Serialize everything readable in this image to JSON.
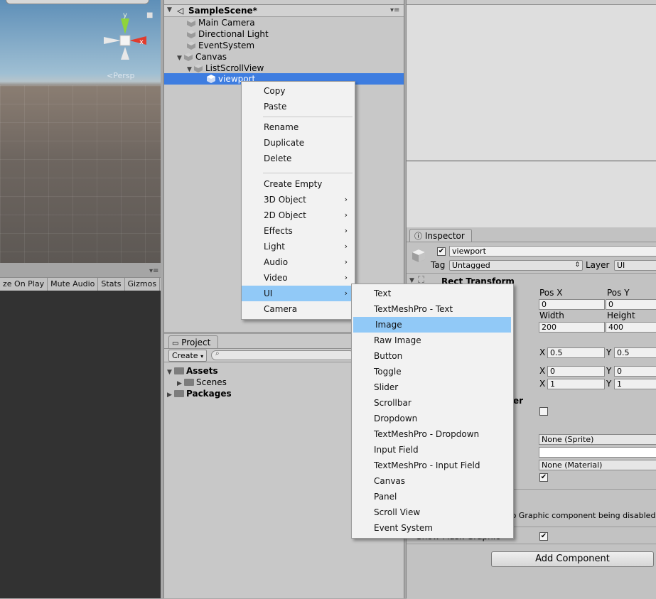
{
  "scene_view": {
    "persp_label": "<Persp",
    "axis_y": "y",
    "axis_x": "x"
  },
  "game_toolbar": {
    "items": [
      "ze On Play",
      "Mute Audio",
      "Stats",
      "Gizmos"
    ]
  },
  "hierarchy": {
    "scene_name": "SampleScene*",
    "items": [
      {
        "label": "Main Camera"
      },
      {
        "label": "Directional Light"
      },
      {
        "label": "EventSystem"
      },
      {
        "label": "Canvas"
      },
      {
        "label": "ListScrollView"
      },
      {
        "label": "viewport"
      }
    ]
  },
  "project": {
    "tab_label": "Project",
    "create_label": "Create",
    "tree": [
      {
        "label": "Assets"
      },
      {
        "label": "Scenes"
      },
      {
        "label": "Packages"
      }
    ]
  },
  "inspector": {
    "tab_label": "Inspector",
    "object_name": "viewport",
    "tag_label": "Tag",
    "tag_value": "Untagged",
    "layer_label": "Layer",
    "layer_value": "UI",
    "rect_transform_title": "Rect Transform",
    "pos_x_label": "Pos X",
    "pos_y_label": "Pos Y",
    "pos_x": "0",
    "pos_y": "0",
    "width_label": "Width",
    "height_label": "Height",
    "width": "200",
    "height": "400",
    "anchor_x_label": "X",
    "anchor_y_label": "Y",
    "pivot_x": "0.5",
    "pivot_y": "0.5",
    "min_x": "0",
    "min_y": "0",
    "max_x": "1",
    "max_y": "1",
    "image_header_fragment": "er",
    "sprite_value": "None (Sprite)",
    "material_value": "None (Material)",
    "info_text": "e to Graphic component being disabled.",
    "show_mask_label": "Show Mask Graphic",
    "add_component": "Add Component"
  },
  "context_menu": {
    "items": [
      {
        "label": "Copy"
      },
      {
        "label": "Paste"
      },
      {
        "label": "Rename"
      },
      {
        "label": "Duplicate"
      },
      {
        "label": "Delete"
      },
      {
        "label": "Create Empty"
      },
      {
        "label": "3D Object"
      },
      {
        "label": "2D Object"
      },
      {
        "label": "Effects"
      },
      {
        "label": "Light"
      },
      {
        "label": "Audio"
      },
      {
        "label": "Video"
      },
      {
        "label": "UI"
      },
      {
        "label": "Camera"
      }
    ],
    "arrow_glyph": "›"
  },
  "ui_submenu": {
    "items": [
      {
        "label": "Text"
      },
      {
        "label": "TextMeshPro - Text"
      },
      {
        "label": "Image"
      },
      {
        "label": "Raw Image"
      },
      {
        "label": "Button"
      },
      {
        "label": "Toggle"
      },
      {
        "label": "Slider"
      },
      {
        "label": "Scrollbar"
      },
      {
        "label": "Dropdown"
      },
      {
        "label": "TextMeshPro - Dropdown"
      },
      {
        "label": "Input Field"
      },
      {
        "label": "TextMeshPro - Input Field"
      },
      {
        "label": "Canvas"
      },
      {
        "label": "Panel"
      },
      {
        "label": "Scroll View"
      },
      {
        "label": "Event System"
      }
    ],
    "highlighted": "Image"
  },
  "colors": {
    "selection_blue": "#3e7de0",
    "menu_highlight": "#91c9f7",
    "gizmo_green": "#8fd43c",
    "gizmo_red": "#e03c2e"
  }
}
